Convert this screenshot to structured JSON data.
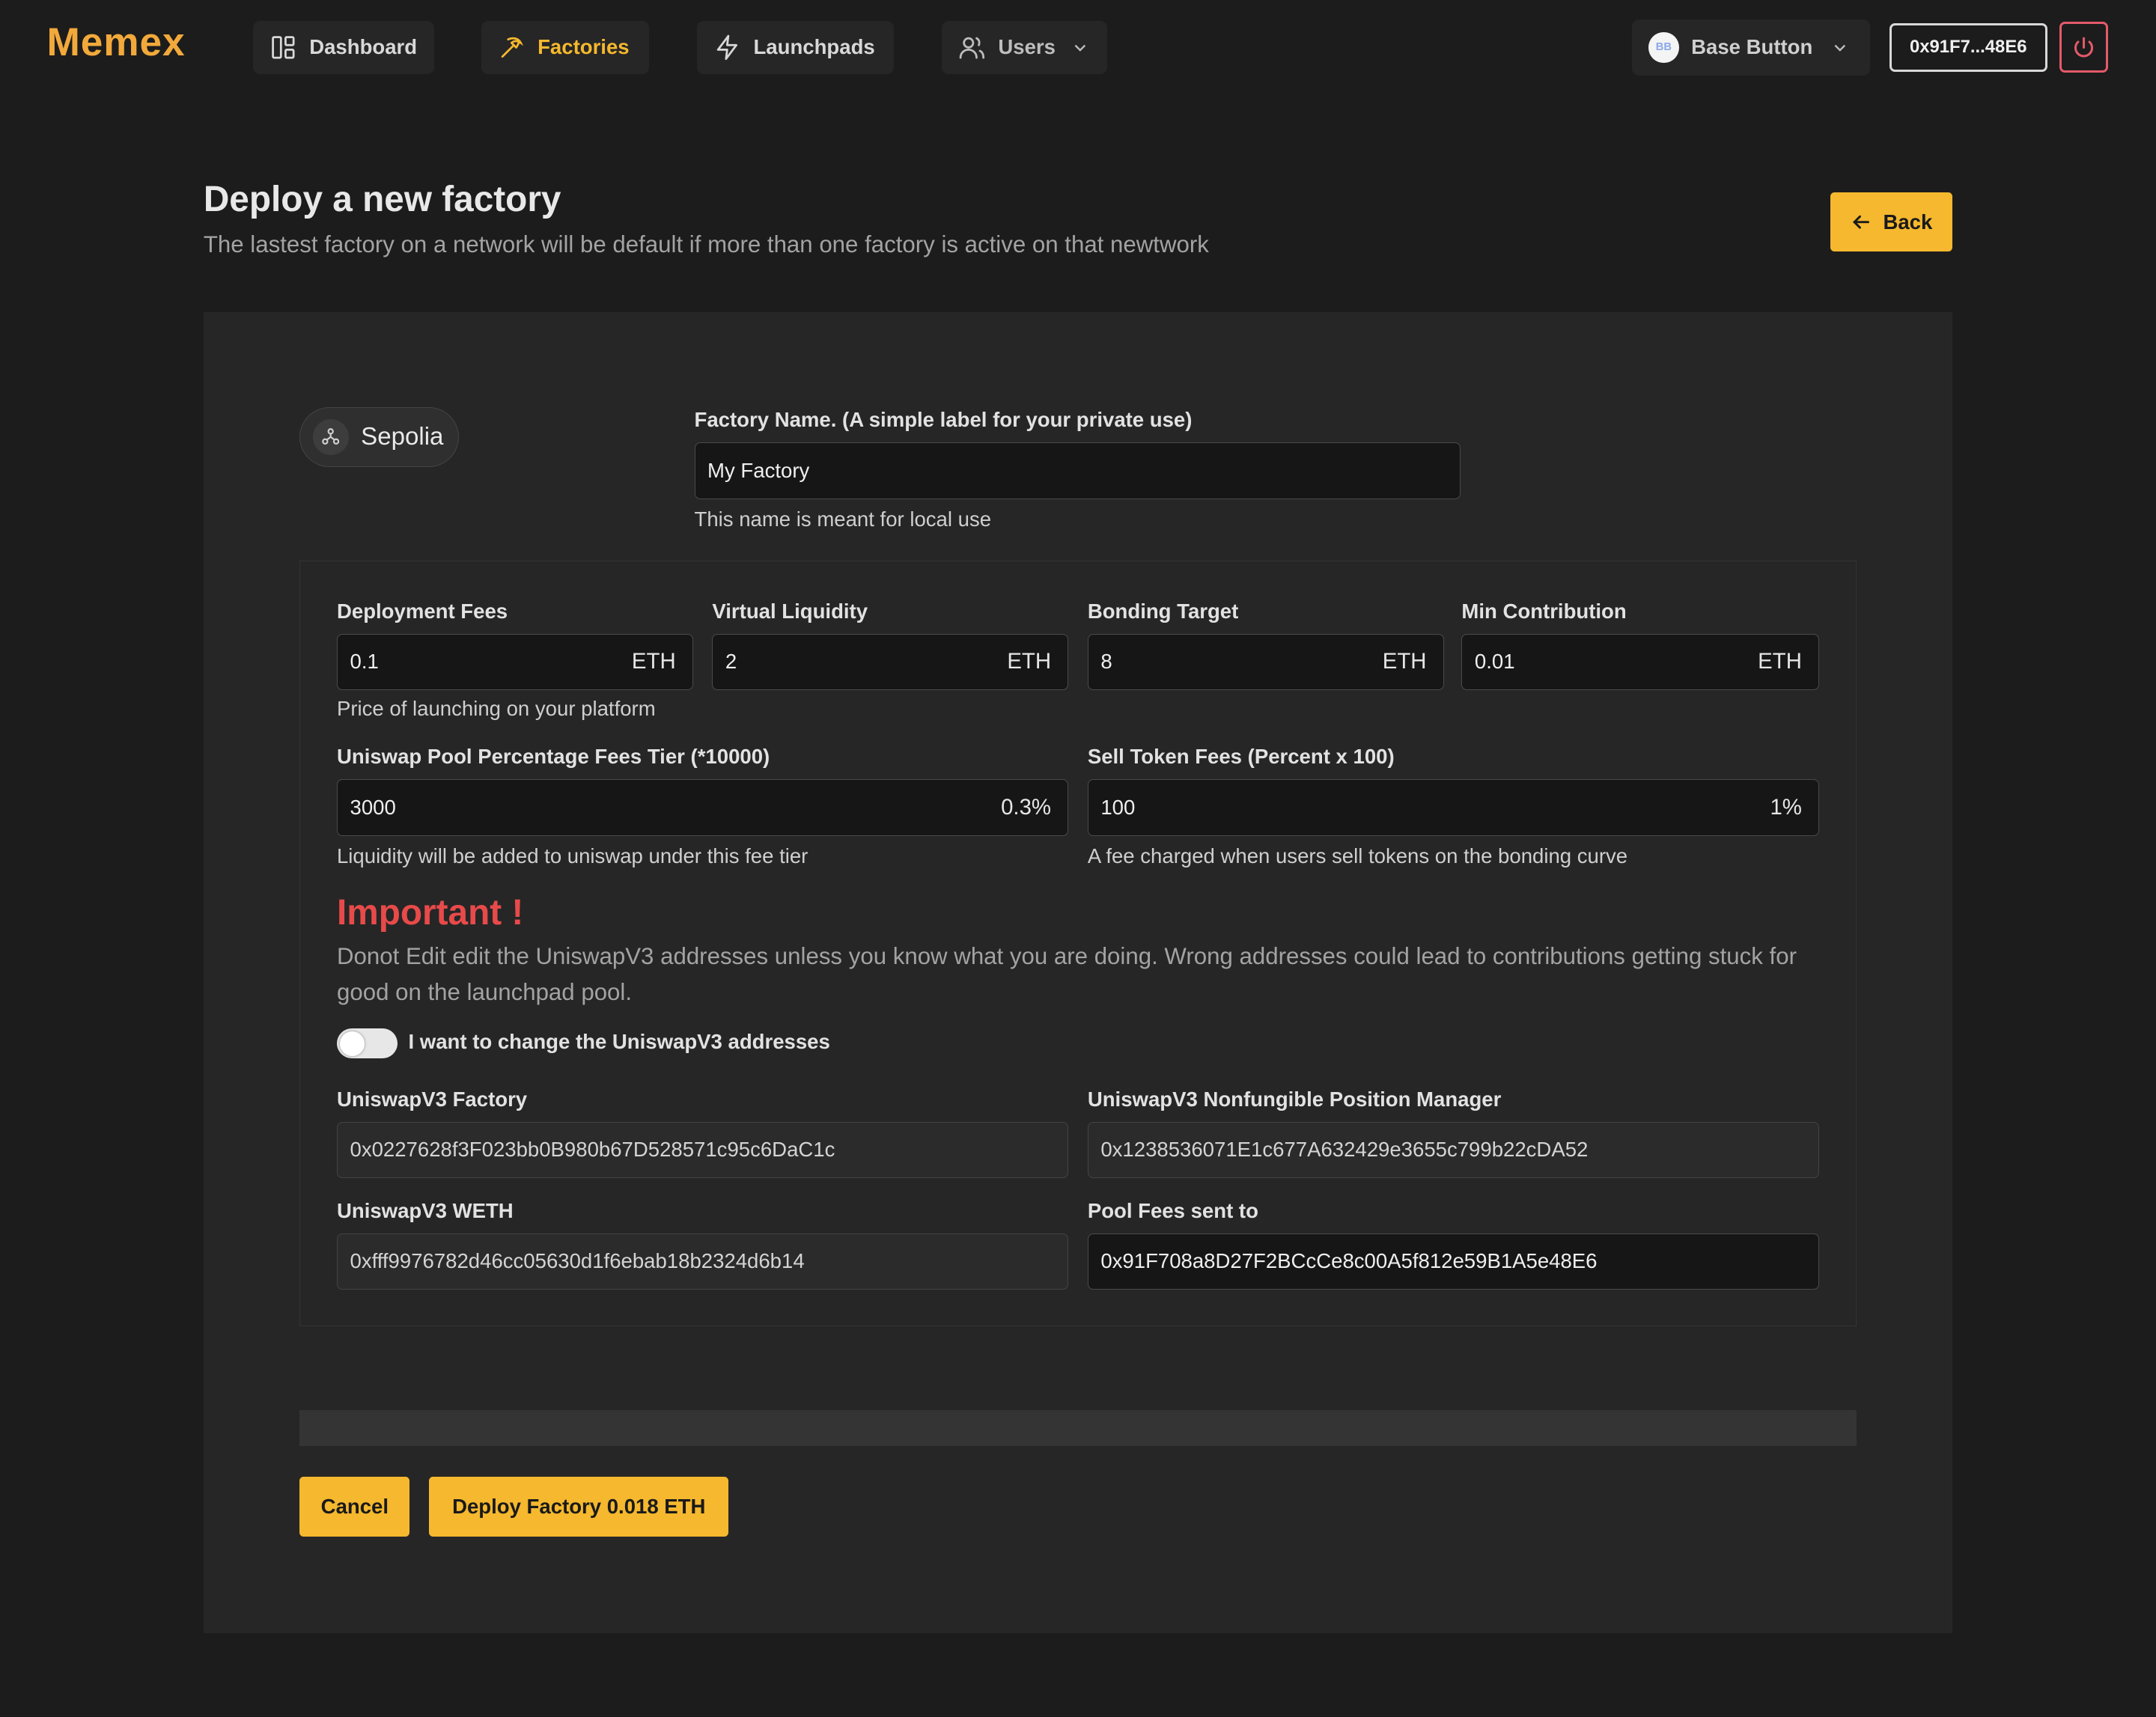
{
  "brand": {
    "logo": "Memex",
    "accent": "#f5b82e",
    "logo_color": "#f2a93b"
  },
  "nav": {
    "items": [
      {
        "label": "Dashboard",
        "icon": "dashboard-icon"
      },
      {
        "label": "Factories",
        "icon": "pickaxe-icon",
        "active": true
      },
      {
        "label": "Launchpads",
        "icon": "lightning-icon"
      },
      {
        "label": "Users",
        "icon": "users-icon"
      }
    ],
    "wallet_button": {
      "avatar": "BB",
      "label": "Base Button"
    },
    "address": "0x91F7...48E6",
    "power_icon": "power-icon"
  },
  "header": {
    "title": "Deploy a new factory",
    "subtitle": "The lastest factory on a network will be default if more than one factory is active on that newtwork",
    "back_label": "Back"
  },
  "form": {
    "network": "Sepolia",
    "factory_name": {
      "label": "Factory Name. (A simple label for your private use)",
      "value": "My Factory",
      "help": "This name is meant for local use"
    },
    "deployment_fees": {
      "label": "Deployment Fees",
      "value": "0.1",
      "unit": "ETH",
      "help": "Price of launching on your platform"
    },
    "virtual_liquidity": {
      "label": "Virtual Liquidity",
      "value": "2",
      "unit": "ETH"
    },
    "bonding_target": {
      "label": "Bonding Target",
      "value": "8",
      "unit": "ETH"
    },
    "min_contribution": {
      "label": "Min Contribution",
      "value": "0.01",
      "unit": "ETH"
    },
    "uniswap_fee_tier": {
      "label": "Uniswap Pool Percentage Fees Tier (*10000)",
      "value": "3000",
      "unit": "0.3%",
      "help": "Liquidity will be added to uniswap under this fee tier"
    },
    "sell_token_fees": {
      "label": "Sell Token Fees (Percent x 100)",
      "value": "100",
      "unit": "1%",
      "help": "A fee charged when users sell tokens on the bonding curve"
    },
    "important": {
      "title": "Important !",
      "text": "Donot Edit edit the UniswapV3 addresses unless you know what you are doing. Wrong addresses could lead to contributions getting stuck for good on the launchpad pool.",
      "color": "#e84a4a"
    },
    "toggle": {
      "label": "I want to change the UniswapV3 addresses",
      "checked": false
    },
    "uniswap_factory": {
      "label": "UniswapV3 Factory",
      "value": "0x0227628f3F023bb0B980b67D528571c95c6DaC1c"
    },
    "position_manager": {
      "label": "UniswapV3 Nonfungible Position Manager",
      "value": "0x1238536071E1c677A632429e3655c799b22cDA52"
    },
    "weth": {
      "label": "UniswapV3 WETH",
      "value": "0xfff9976782d46cc05630d1f6ebab18b2324d6b14"
    },
    "pool_fees_to": {
      "label": "Pool Fees sent to",
      "value": "0x91F708a8D27F2BCcCe8c00A5f812e59B1A5e48E6"
    }
  },
  "actions": {
    "cancel": "Cancel",
    "deploy": "Deploy Factory 0.018 ETH"
  }
}
